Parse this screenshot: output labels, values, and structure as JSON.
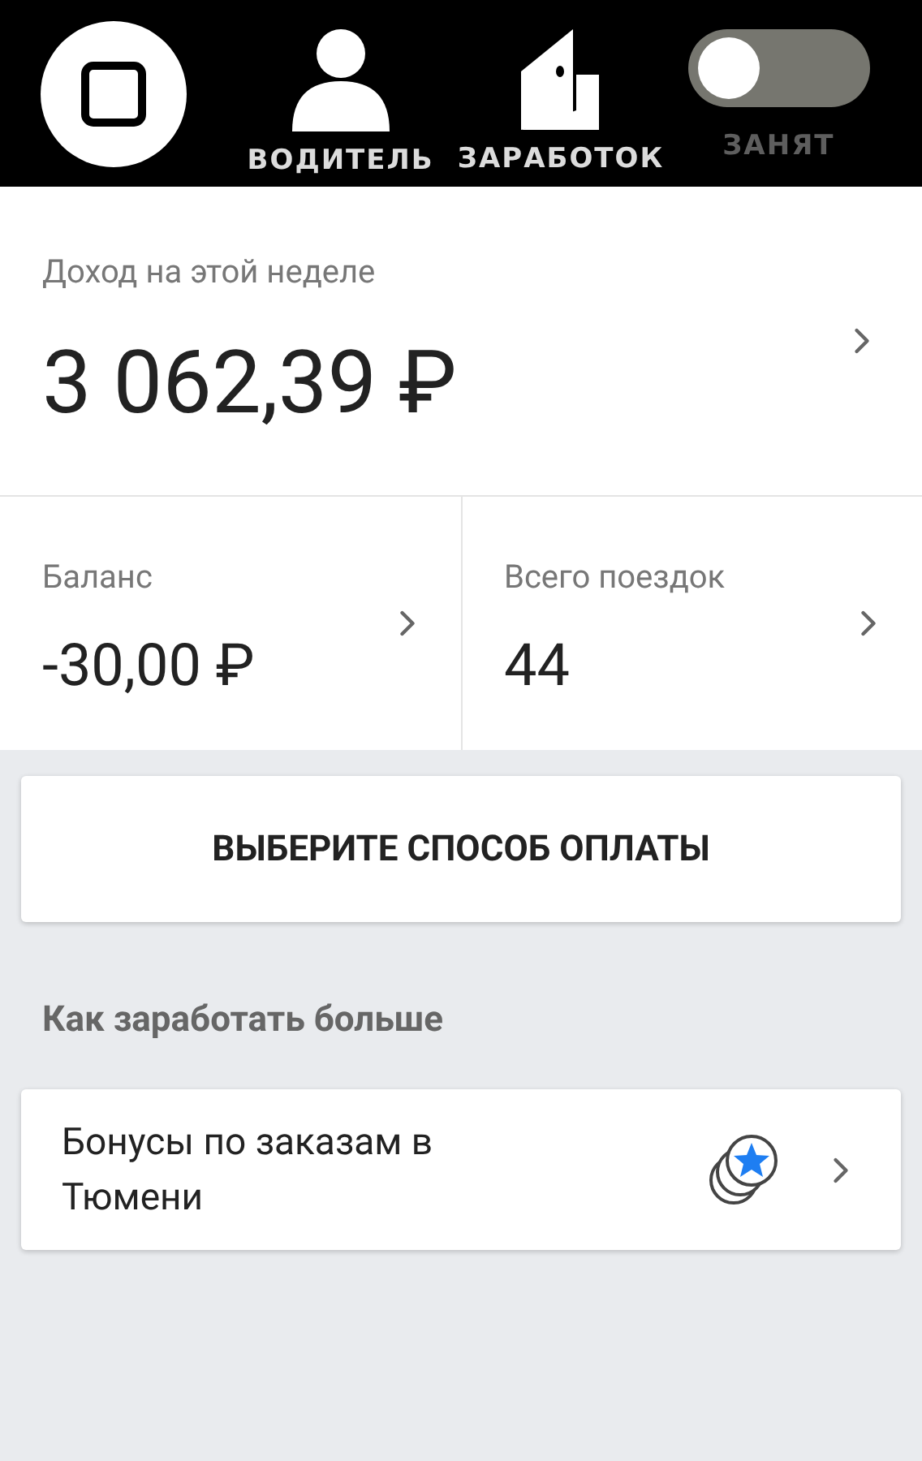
{
  "top_bar": {
    "tabs": [
      {
        "label": "ВОДИТЕЛЬ",
        "kind": "person"
      },
      {
        "label": "ЗАРАБОТОК",
        "kind": "wallet"
      }
    ],
    "status_toggle": {
      "label": "ЗАНЯТ",
      "on": false
    }
  },
  "weekly_income": {
    "label": "Доход на этой неделе",
    "amount": "3 062,39 ₽"
  },
  "stats": [
    {
      "label": "Баланс",
      "value": "-30,00 ₽"
    },
    {
      "label": "Всего поездок",
      "value": "44"
    }
  ],
  "payment_button": "ВЫБЕРИТЕ СПОСОБ ОПЛАТЫ",
  "earn_more": {
    "heading": "Как заработать больше",
    "items": [
      {
        "label": "Бонусы по заказам в Тюмени"
      }
    ]
  }
}
